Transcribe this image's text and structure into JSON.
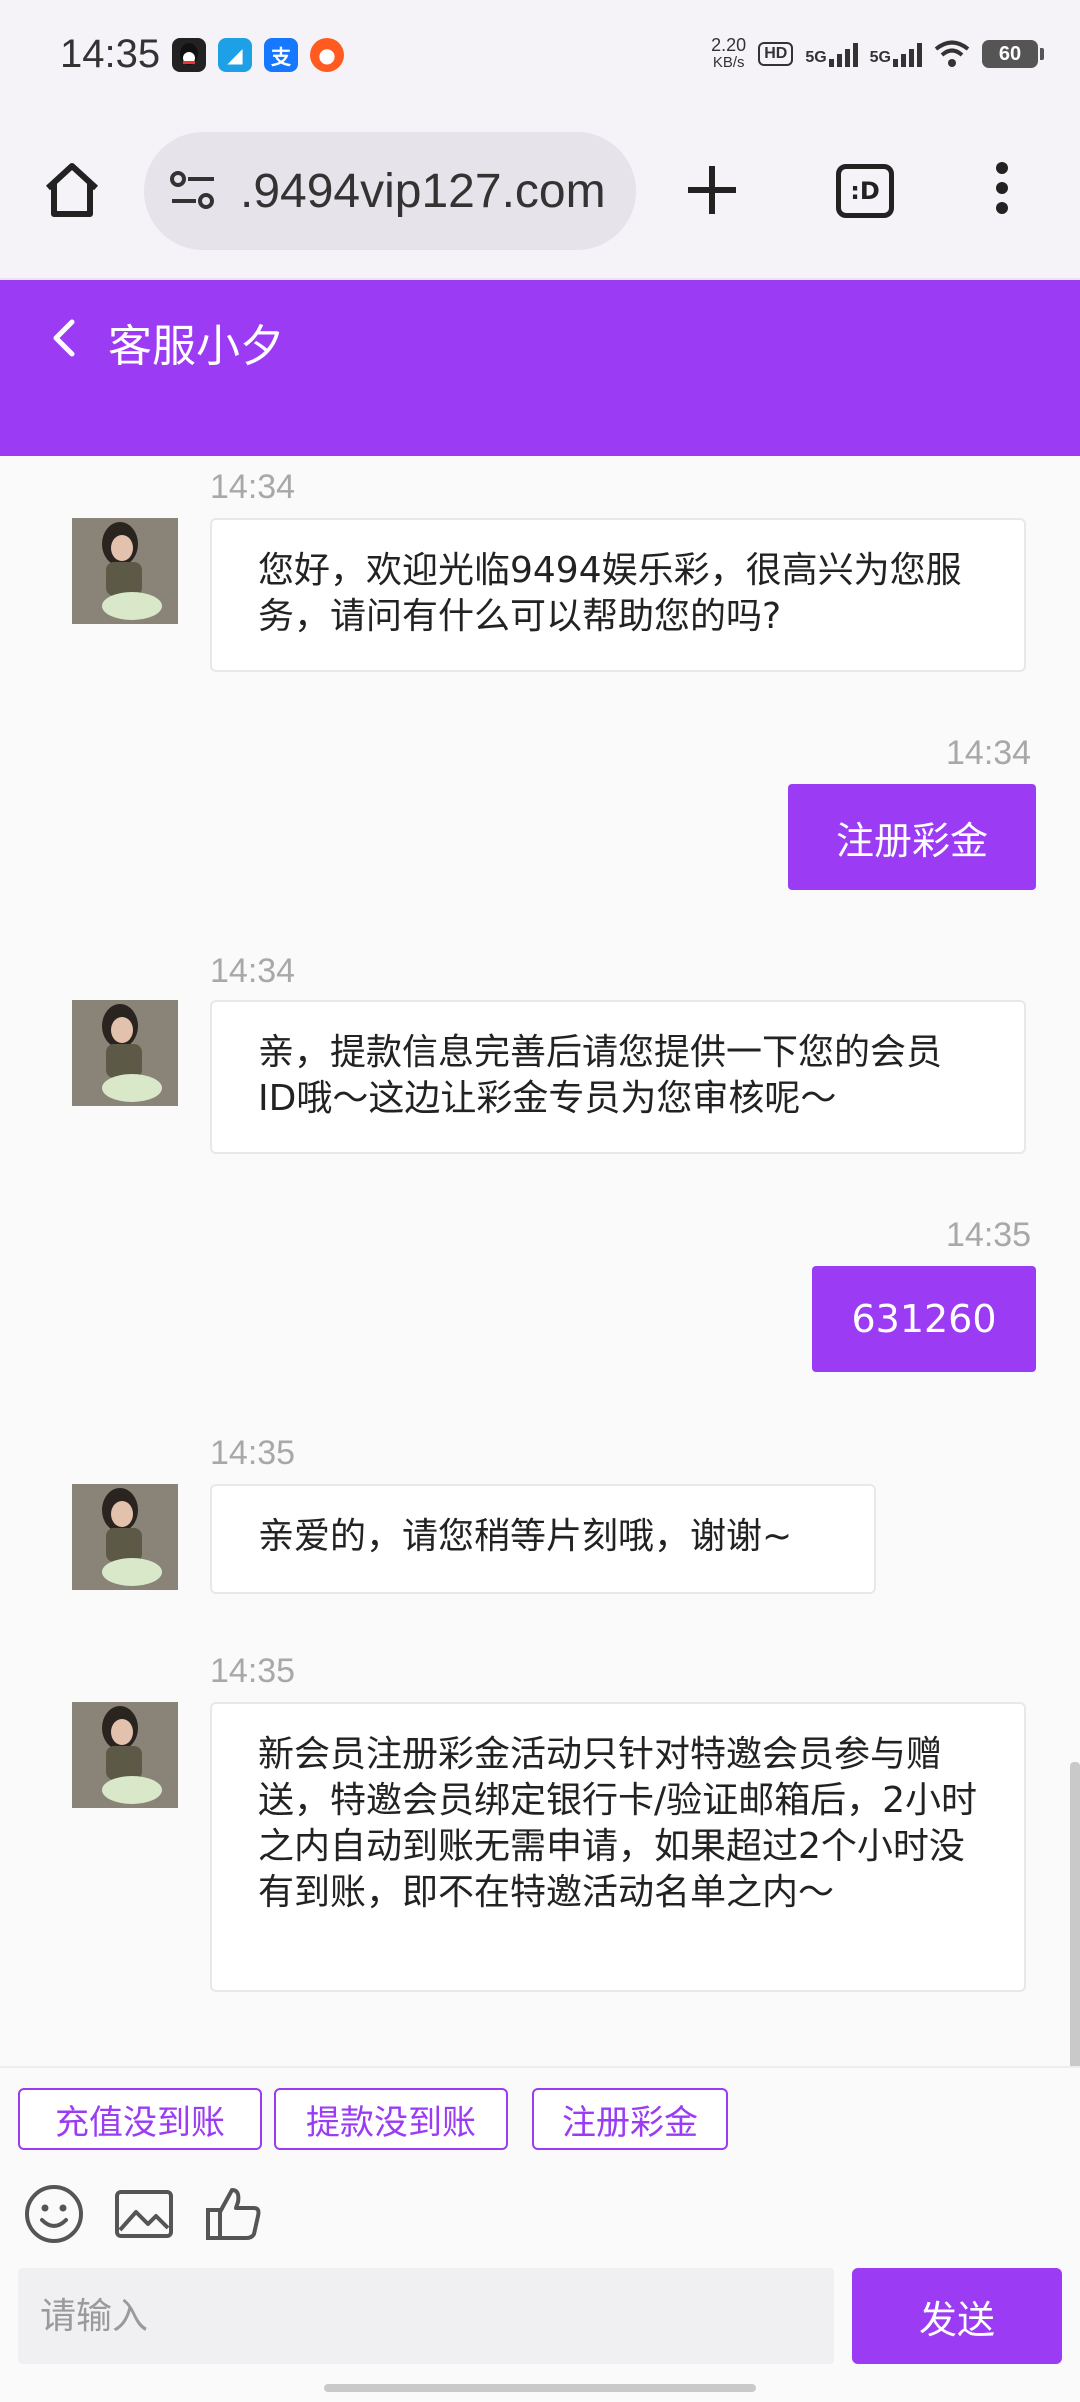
{
  "status_bar": {
    "time": "14:35",
    "net_speed_value": "2.20",
    "net_speed_unit": "KB/s",
    "hd_label": "HD",
    "sig1_label": "5G",
    "sig2_label": "5G",
    "battery": "60",
    "app_icons": [
      "qq-icon",
      "app-icon",
      "alipay-icon",
      "taobao-icon"
    ]
  },
  "browser": {
    "url": ".9494vip127.com",
    "tab_label": ":D"
  },
  "chat": {
    "title": "客服小夕",
    "accent": "#9b3bf4"
  },
  "messages": [
    {
      "side": "in",
      "time": "14:34",
      "text": "您好，欢迎光临9494娱乐彩，很高兴为您服务，请问有什么可以帮助您的吗?"
    },
    {
      "side": "out",
      "time": "14:34",
      "text": "注册彩金"
    },
    {
      "side": "in",
      "time": "14:34",
      "text": "亲，提款信息完善后请您提供一下您的会员ID哦～这边让彩金专员为您审核呢～"
    },
    {
      "side": "out",
      "time": "14:35",
      "text": "631260"
    },
    {
      "side": "in",
      "time": "14:35",
      "text": "亲爱的，请您稍等片刻哦，谢谢~"
    },
    {
      "side": "in",
      "time": "14:35",
      "text": "新会员注册彩金活动只针对特邀会员参与赠送，特邀会员绑定银行卡/验证邮箱后，2小时之内自动到账无需申请，如果超过2个小时没有到账，即不在特邀活动名单之内～"
    }
  ],
  "quick_replies": [
    "充值没到账",
    "提款没到账",
    "注册彩金"
  ],
  "composer": {
    "placeholder": "请输入",
    "send_label": "发送"
  }
}
